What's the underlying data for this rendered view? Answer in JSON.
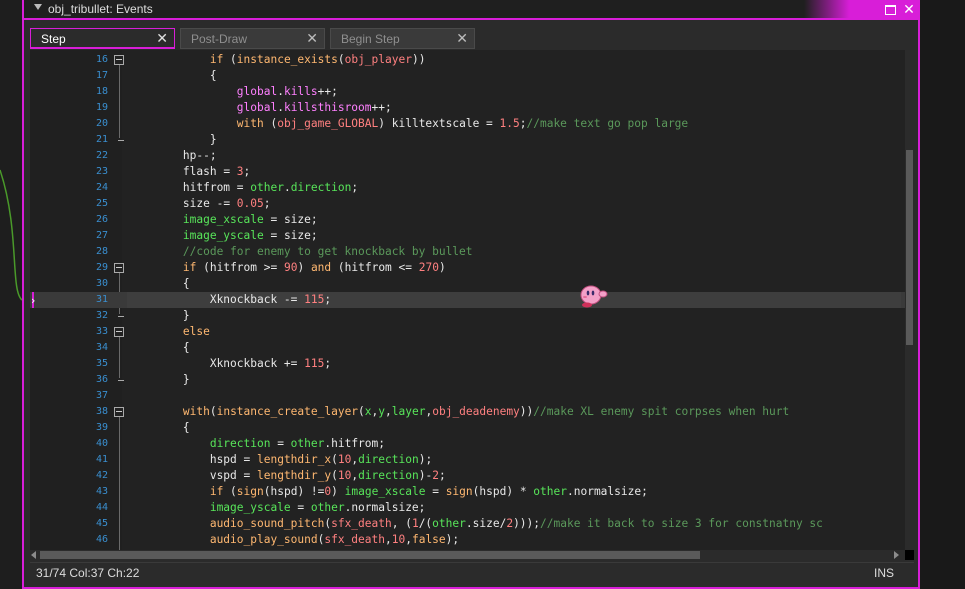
{
  "window": {
    "title": "obj_tribullet: Events",
    "maximize_label": "",
    "close_label": "✕"
  },
  "tabs": [
    {
      "label": "Step",
      "close": "✕"
    },
    {
      "label": "Post-Draw",
      "close": "✕"
    },
    {
      "label": "Begin Step",
      "close": "✕"
    }
  ],
  "editor": {
    "current_line": 31,
    "lines": [
      {
        "n": "16",
        "t": "            <span class=\"k\">if</span> (<span class=\"fn\">instance_exists</span>(<span class=\"obj\">obj_player</span>))"
      },
      {
        "n": "17",
        "t": "            {"
      },
      {
        "n": "18",
        "t": "                <span class=\"pink\">global</span>.<span class=\"pink\">kills</span>++;"
      },
      {
        "n": "19",
        "t": "                <span class=\"pink\">global</span>.<span class=\"pink\">killsthisroom</span>++;"
      },
      {
        "n": "20",
        "t": "                <span class=\"k\">with</span> (<span class=\"obj\">obj_game_GLOBAL</span>) <span class=\"s\">killtextscale</span> = <span class=\"n\">1.5</span>;<span class=\"c\">//make text go pop large</span>"
      },
      {
        "n": "21",
        "t": "            }"
      },
      {
        "n": "22",
        "t": "        <span class=\"s\">hp</span>--;"
      },
      {
        "n": "23",
        "t": "        <span class=\"s\">flash</span> = <span class=\"n\">3</span>;"
      },
      {
        "n": "24",
        "t": "        <span class=\"s\">hitfrom</span> = <span class=\"bi\">other</span>.<span class=\"bi\">direction</span>;"
      },
      {
        "n": "25",
        "t": "        <span class=\"s\">size</span> -= <span class=\"n\">0.05</span>;"
      },
      {
        "n": "26",
        "t": "        <span class=\"bi\">image_xscale</span> = <span class=\"s\">size</span>;"
      },
      {
        "n": "27",
        "t": "        <span class=\"bi\">image_yscale</span> = <span class=\"s\">size</span>;"
      },
      {
        "n": "28",
        "t": "        <span class=\"c\">//code for enemy to get knockback by bullet</span>"
      },
      {
        "n": "29",
        "t": "        <span class=\"k\">if</span> (<span class=\"s\">hitfrom</span> &gt;= <span class=\"n\">90</span>) <span class=\"k\">and</span> (<span class=\"s\">hitfrom</span> &lt;= <span class=\"n\">270</span>)"
      },
      {
        "n": "30",
        "t": "        {"
      },
      {
        "n": "31",
        "t": "            <span class=\"s\">Xknockback</span> -= <span class=\"n\">115</span>;"
      },
      {
        "n": "32",
        "t": "        }"
      },
      {
        "n": "33",
        "t": "        <span class=\"k\">else</span>"
      },
      {
        "n": "34",
        "t": "        {"
      },
      {
        "n": "35",
        "t": "            <span class=\"s\">Xknockback</span> += <span class=\"n\">115</span>;"
      },
      {
        "n": "36",
        "t": "        }"
      },
      {
        "n": "37",
        "t": ""
      },
      {
        "n": "38",
        "t": "        <span class=\"k\">with</span>(<span class=\"fn\">instance_create_layer</span>(<span class=\"bi\">x</span>,<span class=\"bi\">y</span>,<span class=\"bi\">layer</span>,<span class=\"obj\">obj_deadenemy</span>))<span class=\"c\">//make XL enemy spit corpses when hurt</span>"
      },
      {
        "n": "39",
        "t": "        {"
      },
      {
        "n": "40",
        "t": "            <span class=\"bi\">direction</span> = <span class=\"bi\">other</span>.<span class=\"s\">hitfrom</span>;"
      },
      {
        "n": "41",
        "t": "            <span class=\"s\">hspd</span> = <span class=\"fn\">lengthdir_x</span>(<span class=\"n\">10</span>,<span class=\"bi\">direction</span>);"
      },
      {
        "n": "42",
        "t": "            <span class=\"s\">vspd</span> = <span class=\"fn\">lengthdir_y</span>(<span class=\"n\">10</span>,<span class=\"bi\">direction</span>)-<span class=\"n\">2</span>;"
      },
      {
        "n": "43",
        "t": "            <span class=\"k\">if</span> (<span class=\"fn\">sign</span>(<span class=\"s\">hspd</span>) !=<span class=\"n\">0</span>) <span class=\"bi\">image_xscale</span> = <span class=\"fn\">sign</span>(<span class=\"s\">hspd</span>) * <span class=\"bi\">other</span>.<span class=\"s\">normalsize</span>;"
      },
      {
        "n": "44",
        "t": "            <span class=\"bi\">image_yscale</span> = <span class=\"bi\">other</span>.<span class=\"s\">normalsize</span>;"
      },
      {
        "n": "45",
        "t": "            <span class=\"fn\">audio_sound_pitch</span>(<span class=\"obj\">sfx_death</span>, (<span class=\"n\">1</span>/(<span class=\"bi\">other</span>.<span class=\"s\">size</span>/<span class=\"n\">2</span>)));<span class=\"c\">//make it back to size 3 for constnatny sc</span>"
      },
      {
        "n": "46",
        "t": "            <span class=\"fn\">audio_play_sound</span>(<span class=\"obj\">sfx_death</span>,<span class=\"n\">10</span>,<span class=\"k\">false</span>);"
      }
    ]
  },
  "status": {
    "position": "31/74 Col:37 Ch:22",
    "mode": "INS"
  },
  "colors": {
    "accent": "#d81ed8",
    "line_number": "#3a8fd0"
  }
}
